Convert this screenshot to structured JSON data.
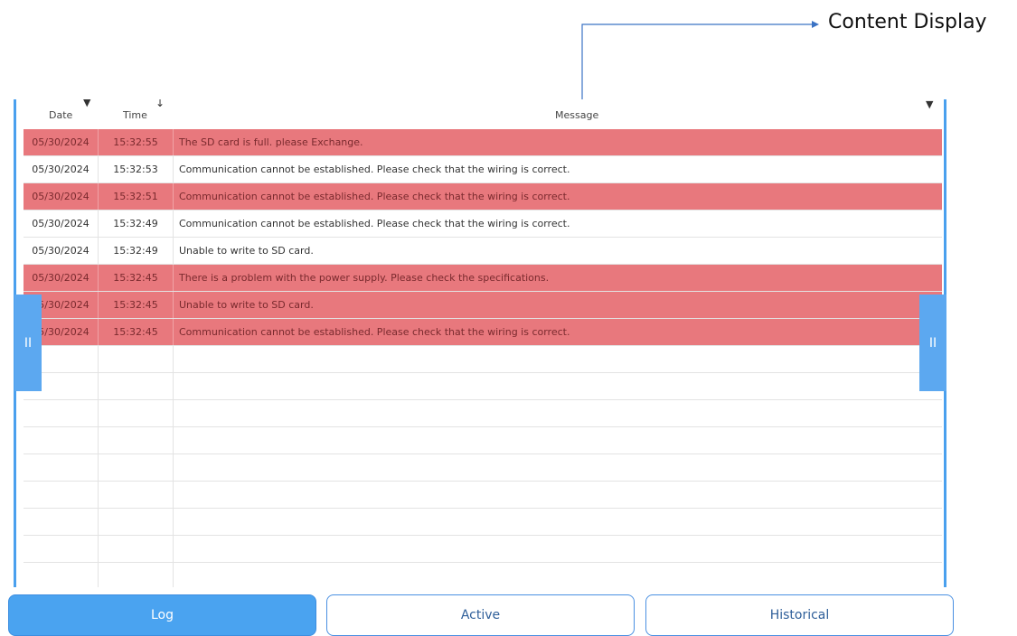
{
  "callout": {
    "label": "Content Display"
  },
  "table": {
    "columns": {
      "date": "Date",
      "time": "Time",
      "message": "Message"
    },
    "rows": [
      {
        "date": "05/30/2024",
        "time": "15:32:55",
        "message": "The SD card is full. please Exchange.",
        "alarm": true
      },
      {
        "date": "05/30/2024",
        "time": "15:32:53",
        "message": "Communication cannot be established. Please check that the wiring is correct.",
        "alarm": false
      },
      {
        "date": "05/30/2024",
        "time": "15:32:51",
        "message": "Communication cannot be established. Please check that the wiring is correct.",
        "alarm": true
      },
      {
        "date": "05/30/2024",
        "time": "15:32:49",
        "message": "Communication cannot be established. Please check that the wiring is correct.",
        "alarm": false
      },
      {
        "date": "05/30/2024",
        "time": "15:32:49",
        "message": "Unable to write to SD card.",
        "alarm": false
      },
      {
        "date": "05/30/2024",
        "time": "15:32:45",
        "message": "There is a problem with the power supply. Please check the specifications.",
        "alarm": true
      },
      {
        "date": "05/30/2024",
        "time": "15:32:45",
        "message": "Unable to write to SD card.",
        "alarm": true
      },
      {
        "date": "05/30/2024",
        "time": "15:32:45",
        "message": "Communication cannot be established. Please check that the wiring is correct.",
        "alarm": true
      },
      {
        "date": "",
        "time": "",
        "message": "",
        "alarm": false
      },
      {
        "date": "",
        "time": "",
        "message": "",
        "alarm": false
      },
      {
        "date": "",
        "time": "",
        "message": "",
        "alarm": false
      },
      {
        "date": "",
        "time": "",
        "message": "",
        "alarm": false
      },
      {
        "date": "",
        "time": "",
        "message": "",
        "alarm": false
      },
      {
        "date": "",
        "time": "",
        "message": "",
        "alarm": false
      },
      {
        "date": "",
        "time": "",
        "message": "",
        "alarm": false
      },
      {
        "date": "",
        "time": "",
        "message": "",
        "alarm": false
      },
      {
        "date": "",
        "time": "",
        "message": "",
        "alarm": false
      },
      {
        "date": "",
        "time": "",
        "message": "",
        "alarm": false
      }
    ]
  },
  "handles": {
    "glyph": "II"
  },
  "tabs": [
    {
      "label": "Log",
      "selected": true
    },
    {
      "label": "Active",
      "selected": false
    },
    {
      "label": "Historical",
      "selected": false
    }
  ],
  "colors": {
    "accent": "#4aa3f0",
    "alarm_row": "#e8787d"
  }
}
